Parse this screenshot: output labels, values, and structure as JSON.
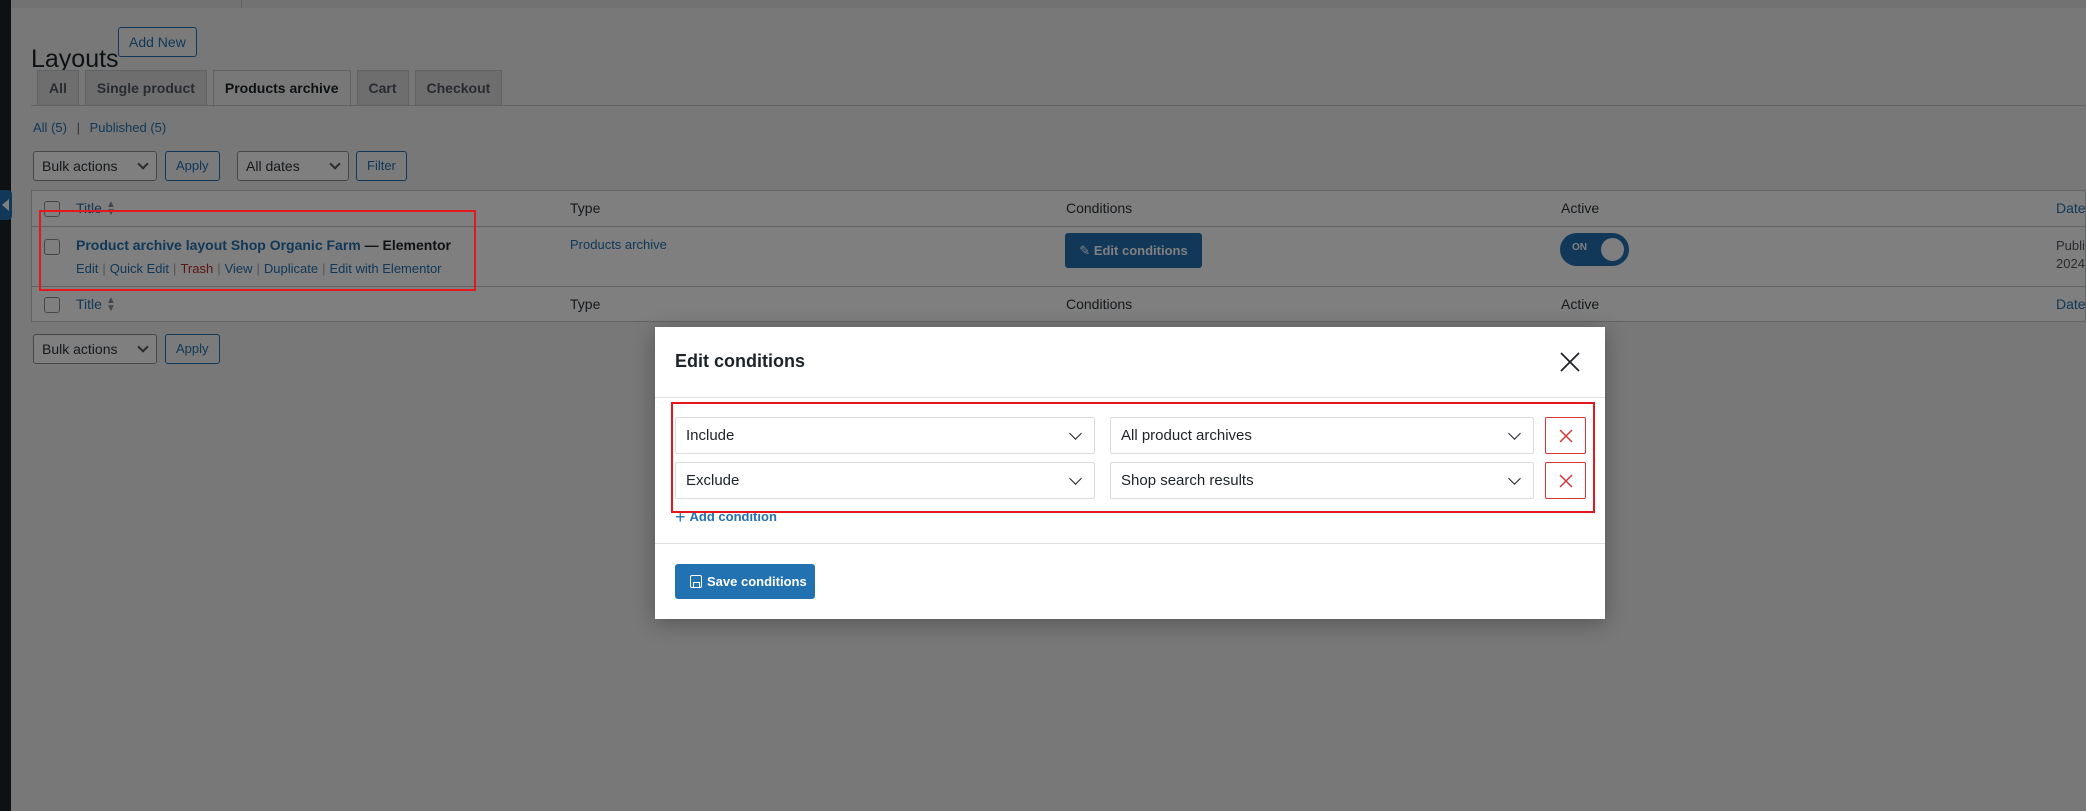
{
  "page": {
    "title": "Layouts",
    "add_new_label": "Add New"
  },
  "tabs": [
    {
      "label": "All",
      "active": false
    },
    {
      "label": "Single product",
      "active": false
    },
    {
      "label": "Products archive",
      "active": true
    },
    {
      "label": "Cart",
      "active": false
    },
    {
      "label": "Checkout",
      "active": false
    }
  ],
  "filters": {
    "all_label": "All",
    "all_count": "(5)",
    "published_label": "Published",
    "published_count": "(5)",
    "separator": "|"
  },
  "toolbar": {
    "bulk_actions": "Bulk actions",
    "apply_label": "Apply",
    "all_dates": "All dates",
    "filter_label": "Filter"
  },
  "table": {
    "headers": {
      "title": "Title",
      "type": "Type",
      "conditions": "Conditions",
      "active": "Active",
      "date": "Date"
    },
    "row": {
      "title": "Product archive layout Shop Organic Farm",
      "title_suffix": "— Elementor",
      "actions": [
        "Edit",
        "Quick Edit",
        "Trash",
        "View",
        "Duplicate",
        "Edit with Elementor"
      ],
      "type": "Products archive",
      "edit_conditions_label": "Edit conditions",
      "toggle_label": "ON",
      "date_line1": "Publi",
      "date_line2": "2024"
    }
  },
  "modal": {
    "title": "Edit conditions",
    "conditions": [
      {
        "mode": "Include",
        "target": "All product archives"
      },
      {
        "mode": "Exclude",
        "target": "Shop search results"
      }
    ],
    "add_condition_label": "Add condition",
    "save_label": "Save conditions"
  },
  "colors": {
    "accent": "#2271b1",
    "highlight": "#e3171e",
    "danger": "#d63638"
  }
}
